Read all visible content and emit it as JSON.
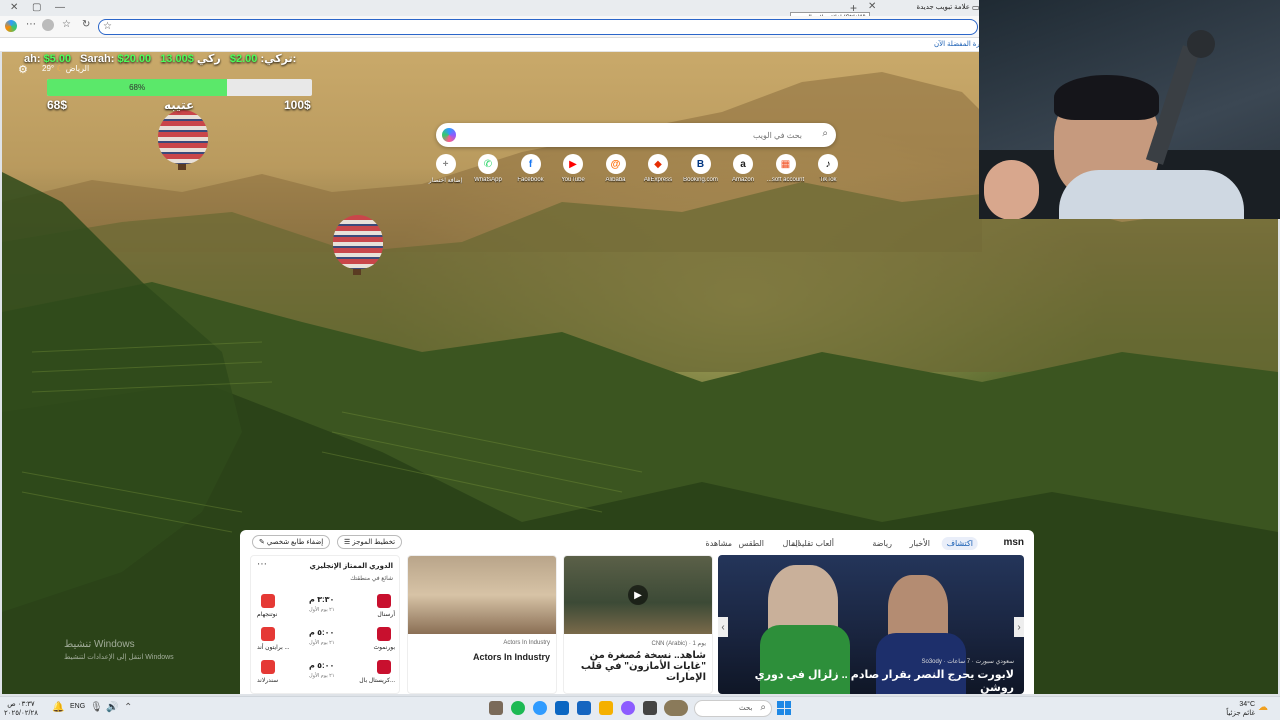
{
  "browser": {
    "tab_title": "علامة تبويب جديدة",
    "tooltip": "إغلاق علامة التبويب (Ctrl+W)",
    "favorites_bar_text": "إدارة المفضلة الآن",
    "icons": [
      "edge-icon",
      "profile-icon",
      "more-icon",
      "favorite-icon",
      "refresh-icon",
      "star-icon",
      "new-tab-icon",
      "close-tab-icon",
      "minimize-icon",
      "maximize-icon"
    ]
  },
  "hud": {
    "player1_label": "ركي:",
    "player1_value": "2.00$",
    "player2_label": "تركي:",
    "player2_value": "13.00$",
    "player3_label": "Sarah:",
    "player3_value": "$20.00",
    "player4_label": "ah:",
    "player4_value": "$5.00",
    "city": "الرياض",
    "temperature": "29°",
    "progress_percent": 68,
    "progress_text": "68%",
    "min_label": "68$",
    "center_label": "عتيبه",
    "max_label": "100$"
  },
  "search": {
    "placeholder": "بحث في الويب"
  },
  "quick_links": [
    {
      "label": "TikTok",
      "glyph": "♪",
      "color": "#000000"
    },
    {
      "label": "...soft account",
      "glyph": "▦",
      "color": "#f25022"
    },
    {
      "label": "Amazon",
      "glyph": "a",
      "color": "#222222"
    },
    {
      "label": "Booking.com",
      "glyph": "B",
      "color": "#003580"
    },
    {
      "label": "AliExpress",
      "glyph": "◆",
      "color": "#e62e04"
    },
    {
      "label": "Alibaba",
      "glyph": "@",
      "color": "#ff6a00"
    },
    {
      "label": "YouTube",
      "glyph": "▶",
      "color": "#ff0000"
    },
    {
      "label": "Facebook",
      "glyph": "f",
      "color": "#1877f2"
    },
    {
      "label": "WhatsApp",
      "glyph": "✆",
      "color": "#25d366"
    },
    {
      "label": "إضافة اختصار",
      "glyph": "+",
      "color": "#888888"
    }
  ],
  "msn": {
    "logo": "msn",
    "tabs": [
      "اكتشاف",
      "الأخبار",
      "رياضة",
      "ألعاب تقليدية",
      "المال",
      "الطقس",
      "مشاهدة"
    ],
    "buttons": {
      "customize": "تخطيط الموجز",
      "personalize": "إضفاء طابع شخصي"
    },
    "main_story": {
      "source": "So3ody · سعودي سبورت · 7 ساعات",
      "title": "لابورت يحرج النصر بقرار صادم .. زلزال في دوري روشن"
    },
    "video_story": {
      "source": "CNN (Arabic) · 1 يوم",
      "title": "شاهد.. نسخة مُصغرة من \"غابات الأمازون\" في قلب الإمارات"
    },
    "side_story": {
      "source": "Actors In Industry",
      "title": "Actors In Industry"
    },
    "league": {
      "title": "الدوري الممتاز الإنجليزي",
      "subtitle": "شائع في منطقتك",
      "matches": [
        {
          "home": "أرسنال",
          "away": "نوتنجهام",
          "time": "٣:٣٠ م",
          "note": "٢١ يوم الأول"
        },
        {
          "home": "بورنموث",
          "away": "برايتون أند ...",
          "time": "٥:٠٠ م",
          "note": "٢١ يوم الأول"
        },
        {
          "home": "كريستال بال...",
          "away": "سندرلاند",
          "time": "٥:٠٠ م",
          "note": "٢١ يوم الأول"
        }
      ]
    }
  },
  "watermark": {
    "line1": "تنشيط Windows",
    "line2": "انتقل إلى الإعدادات لتنشيط Windows"
  },
  "taskbar": {
    "search_placeholder": "بحث",
    "language": "ENG",
    "time": "٠٣:٣٧ ص",
    "date": "٢٠٢٥/٠٢/٢٨",
    "weather_temp": "34°C",
    "weather_desc": "غائم جزئياً"
  }
}
